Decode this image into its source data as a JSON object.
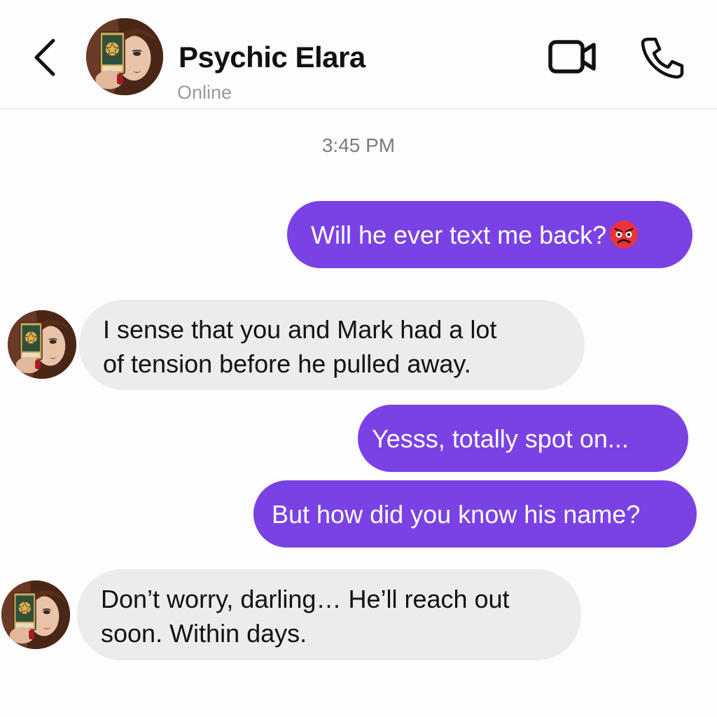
{
  "header": {
    "contact_name": "Psychic Elara",
    "status": "Online",
    "back_icon": "chevron-left-icon",
    "video_icon": "video-camera-icon",
    "call_icon": "phone-icon"
  },
  "thread": {
    "timestamp": "3:45 PM",
    "messages": [
      {
        "sender": "me",
        "text": "Will he ever text me back?",
        "emoji": "angry-face-emoji"
      },
      {
        "sender": "Psychic Elara",
        "lines": [
          "I sense that you and Mark had a lot",
          "of tension before he pulled away."
        ]
      },
      {
        "sender": "me",
        "text": "Yesss, totally spot on..."
      },
      {
        "sender": "me",
        "text": "But how did you know his name?"
      },
      {
        "sender": "Psychic Elara",
        "lines": [
          "Don’t worry, darling… He’ll reach out",
          "soon. Within days."
        ]
      }
    ]
  },
  "colors": {
    "sent_bubble": "#7a42e4",
    "received_bubble": "#ececec",
    "background": "#fdfdfd"
  }
}
